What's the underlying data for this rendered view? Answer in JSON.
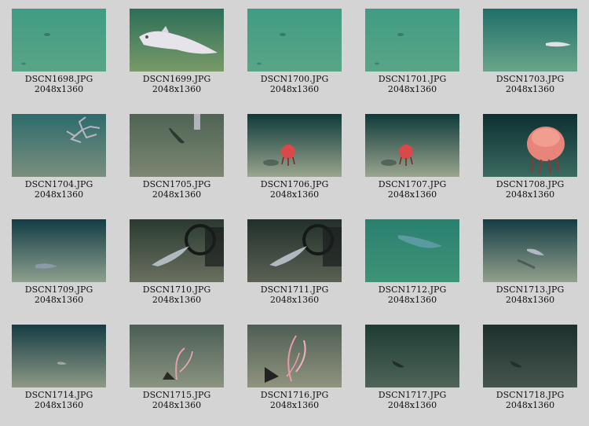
{
  "gallery": {
    "items": [
      {
        "filename": "DSCN1698.JPG",
        "dims": "2048x1360",
        "scene": "green-seafloor",
        "subject": "none",
        "colors": {
          "top": "#3f9c84",
          "bottom": "#5aa586"
        }
      },
      {
        "filename": "DSCN1699.JPG",
        "dims": "2048x1360",
        "scene": "green-seafloor",
        "subject": "white-fish-large",
        "colors": {
          "top": "#2c6f58",
          "bottom": "#789a68"
        }
      },
      {
        "filename": "DSCN1700.JPG",
        "dims": "2048x1360",
        "scene": "green-seafloor",
        "subject": "none",
        "colors": {
          "top": "#3f9c84",
          "bottom": "#5aa586"
        }
      },
      {
        "filename": "DSCN1701.JPG",
        "dims": "2048x1360",
        "scene": "green-seafloor",
        "subject": "none",
        "colors": {
          "top": "#3f9c84",
          "bottom": "#5aa586"
        }
      },
      {
        "filename": "DSCN1703.JPG",
        "dims": "2048x1360",
        "scene": "green-seafloor",
        "subject": "small-fish",
        "colors": {
          "top": "#1f6f68",
          "bottom": "#6aa58a"
        }
      },
      {
        "filename": "DSCN1704.JPG",
        "dims": "2048x1360",
        "scene": "teal-seafloor",
        "subject": "brittle-star",
        "colors": {
          "top": "#2d6b6b",
          "bottom": "#7a8f7e"
        }
      },
      {
        "filename": "DSCN1705.JPG",
        "dims": "2048x1360",
        "scene": "olive-seafloor",
        "subject": "dark-fish",
        "colors": {
          "top": "#4f6454",
          "bottom": "#7c8672"
        }
      },
      {
        "filename": "DSCN1706.JPG",
        "dims": "2048x1360",
        "scene": "dark-teal-seafloor",
        "subject": "red-jellyfish-small",
        "colors": {
          "top": "#0e3a3a",
          "bottom": "#9aa58e"
        }
      },
      {
        "filename": "DSCN1707.JPG",
        "dims": "2048x1360",
        "scene": "dark-teal-seafloor",
        "subject": "red-jellyfish-small",
        "colors": {
          "top": "#0e3a3a",
          "bottom": "#9aa58e"
        }
      },
      {
        "filename": "DSCN1708.JPG",
        "dims": "2048x1360",
        "scene": "dark-teal-water",
        "subject": "red-jellyfish-large",
        "colors": {
          "top": "#0c3030",
          "bottom": "#3a6a60"
        }
      },
      {
        "filename": "DSCN1709.JPG",
        "dims": "2048x1360",
        "scene": "dark-teal-seafloor",
        "subject": "small-fish-low",
        "colors": {
          "top": "#123c46",
          "bottom": "#8ea08e"
        }
      },
      {
        "filename": "DSCN1710.JPG",
        "dims": "2048x1360",
        "scene": "dark-olive-seafloor",
        "subject": "fish-with-trap",
        "colors": {
          "top": "#2a3a30",
          "bottom": "#6a7060"
        }
      },
      {
        "filename": "DSCN1711.JPG",
        "dims": "2048x1360",
        "scene": "dark-olive-seafloor",
        "subject": "fish-with-trap",
        "colors": {
          "top": "#22302a",
          "bottom": "#5a6254"
        }
      },
      {
        "filename": "DSCN1712.JPG",
        "dims": "2048x1360",
        "scene": "green-seafloor",
        "subject": "teal-fish",
        "colors": {
          "top": "#2a8070",
          "bottom": "#3e9476"
        }
      },
      {
        "filename": "DSCN1713.JPG",
        "dims": "2048x1360",
        "scene": "dark-teal-seafloor",
        "subject": "small-fish-shadow",
        "colors": {
          "top": "#153c44",
          "bottom": "#92a08c"
        }
      },
      {
        "filename": "DSCN1714.JPG",
        "dims": "2048x1360",
        "scene": "dark-teal-seafloor",
        "subject": "tiny-fish",
        "colors": {
          "top": "#153c44",
          "bottom": "#8e9a86"
        }
      },
      {
        "filename": "DSCN1715.JPG",
        "dims": "2048x1360",
        "scene": "olive-seafloor",
        "subject": "pink-coral-small",
        "colors": {
          "top": "#4a5e54",
          "bottom": "#8c9482"
        }
      },
      {
        "filename": "DSCN1716.JPG",
        "dims": "2048x1360",
        "scene": "olive-seafloor",
        "subject": "pink-coral-large",
        "colors": {
          "top": "#4e5e54",
          "bottom": "#90947e"
        }
      },
      {
        "filename": "DSCN1717.JPG",
        "dims": "2048x1360",
        "scene": "dark-green-seafloor",
        "subject": "dark-fish-small",
        "colors": {
          "top": "#1e3c34",
          "bottom": "#4e6458"
        }
      },
      {
        "filename": "DSCN1718.JPG",
        "dims": "2048x1360",
        "scene": "dark-seafloor",
        "subject": "dark-fish-small",
        "colors": {
          "top": "#1c302c",
          "bottom": "#46544e"
        }
      }
    ]
  }
}
